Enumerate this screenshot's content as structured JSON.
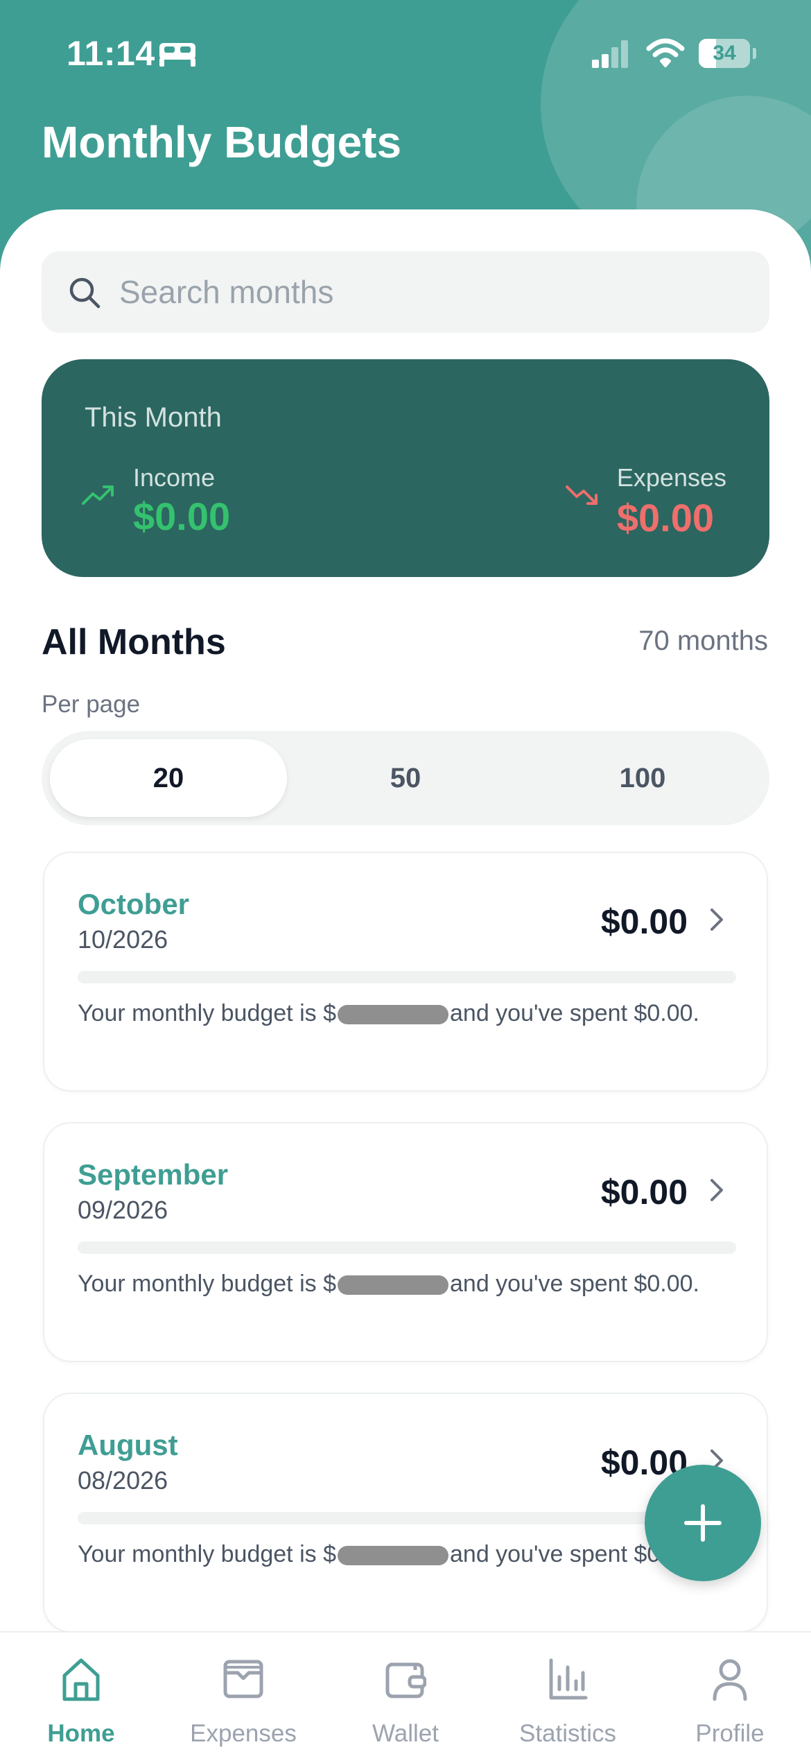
{
  "status_bar": {
    "time": "11:14",
    "battery": "34",
    "battery_level": 0.34
  },
  "header": {
    "title": "Monthly Budgets"
  },
  "search": {
    "placeholder": "Search months"
  },
  "summary": {
    "title": "This Month",
    "income_label": "Income",
    "income_value": "$0.00",
    "expenses_label": "Expenses",
    "expenses_value": "$0.00"
  },
  "months_section": {
    "title": "All Months",
    "count": "70 months",
    "per_page_label": "Per page",
    "per_page_options": [
      "20",
      "50",
      "100"
    ],
    "per_page_selected": "20"
  },
  "months": [
    {
      "name": "October",
      "date": "10/2026",
      "amount": "$0.00",
      "text_before": "Your monthly budget is $",
      "text_after": "and you've spent $0.00.",
      "progress": 0
    },
    {
      "name": "September",
      "date": "09/2026",
      "amount": "$0.00",
      "text_before": "Your monthly budget is $",
      "text_after": "and you've spent $0.00.",
      "progress": 0
    },
    {
      "name": "August",
      "date": "08/2026",
      "amount": "$0.00",
      "text_before": "Your monthly budget is $",
      "text_after": "and you've spent $0.00.",
      "progress": 0
    }
  ],
  "tabbar": {
    "items": [
      {
        "label": "Home",
        "icon": "home-icon",
        "active": true
      },
      {
        "label": "Expenses",
        "icon": "envelope-icon",
        "active": false
      },
      {
        "label": "Wallet",
        "icon": "wallet-icon",
        "active": false
      },
      {
        "label": "Statistics",
        "icon": "bar-chart-icon",
        "active": false
      },
      {
        "label": "Profile",
        "icon": "user-icon",
        "active": false
      }
    ]
  },
  "colors": {
    "primary": "#3f9e93",
    "summary_bg": "#2c6660",
    "income": "#34c26e",
    "expense": "#ef6f6c"
  }
}
